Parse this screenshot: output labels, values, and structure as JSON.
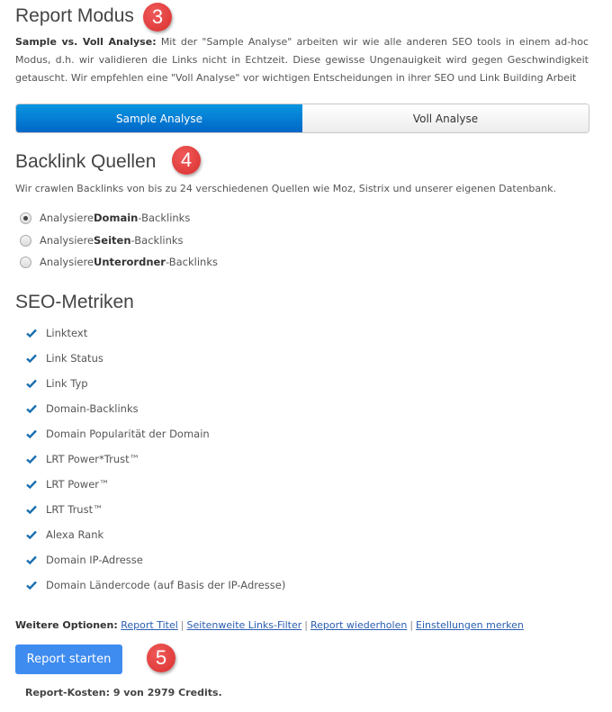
{
  "report_mode": {
    "title": "Report Modus",
    "badge": "3",
    "description_label": "Sample vs. Voll Analyse:",
    "description_text": " Mit der \"Sample Analyse\" arbeiten wir wie alle anderen SEO tools in einem ad-hoc Modus, d.h. wir validieren die Links nicht in Echtzeit. Diese gewisse Ungenauigkeit wird gegen Geschwindigkeit getauscht. Wir empfehlen eine \"Voll Analyse\" vor wichtigen Entscheidungen in ihrer SEO und Link Building Arbeit",
    "options": [
      {
        "label": "Sample Analyse",
        "active": true
      },
      {
        "label": "Voll Analyse",
        "active": false
      }
    ]
  },
  "backlink_sources": {
    "title": "Backlink Quellen",
    "badge": "4",
    "description": "Wir crawlen Backlinks von bis zu 24 verschiedenen Quellen wie Moz, Sistrix und unserer eigenen Datenbank.",
    "radios": [
      {
        "prefix": "Analysiere ",
        "bold": "Domain",
        "suffix": "-Backlinks",
        "checked": true
      },
      {
        "prefix": "Analysiere ",
        "bold": "Seiten",
        "suffix": "-Backlinks",
        "checked": false
      },
      {
        "prefix": "Analysiere ",
        "bold": "Unterordner",
        "suffix": "-Backlinks",
        "checked": false
      }
    ]
  },
  "seo_metrics": {
    "title": "SEO-Metriken",
    "icon": "checkmark-icon",
    "items": [
      "Linktext",
      "Link Status",
      "Link Typ",
      "Domain-Backlinks",
      "Domain Popularität der Domain",
      "LRT Power*Trust™",
      "LRT Power™",
      "LRT Trust™",
      "Alexa Rank",
      "Domain IP-Adresse",
      "Domain Ländercode (auf Basis der IP-Adresse)"
    ]
  },
  "more_options": {
    "label": "Weitere Optionen:",
    "links": [
      "Report Titel",
      "Seitenweite Links-Filter",
      "Report wiederholen",
      "Einstellungen merken"
    ],
    "separator": "|"
  },
  "start_button": {
    "label": "Report starten",
    "badge": "5"
  },
  "cost": "Report-Kosten: 9 von 2979 Credits.",
  "colors": {
    "accent": "#0a7ad6",
    "button": "#3f8cf0",
    "badge": "#e03a38",
    "check": "#1a6fb0"
  }
}
